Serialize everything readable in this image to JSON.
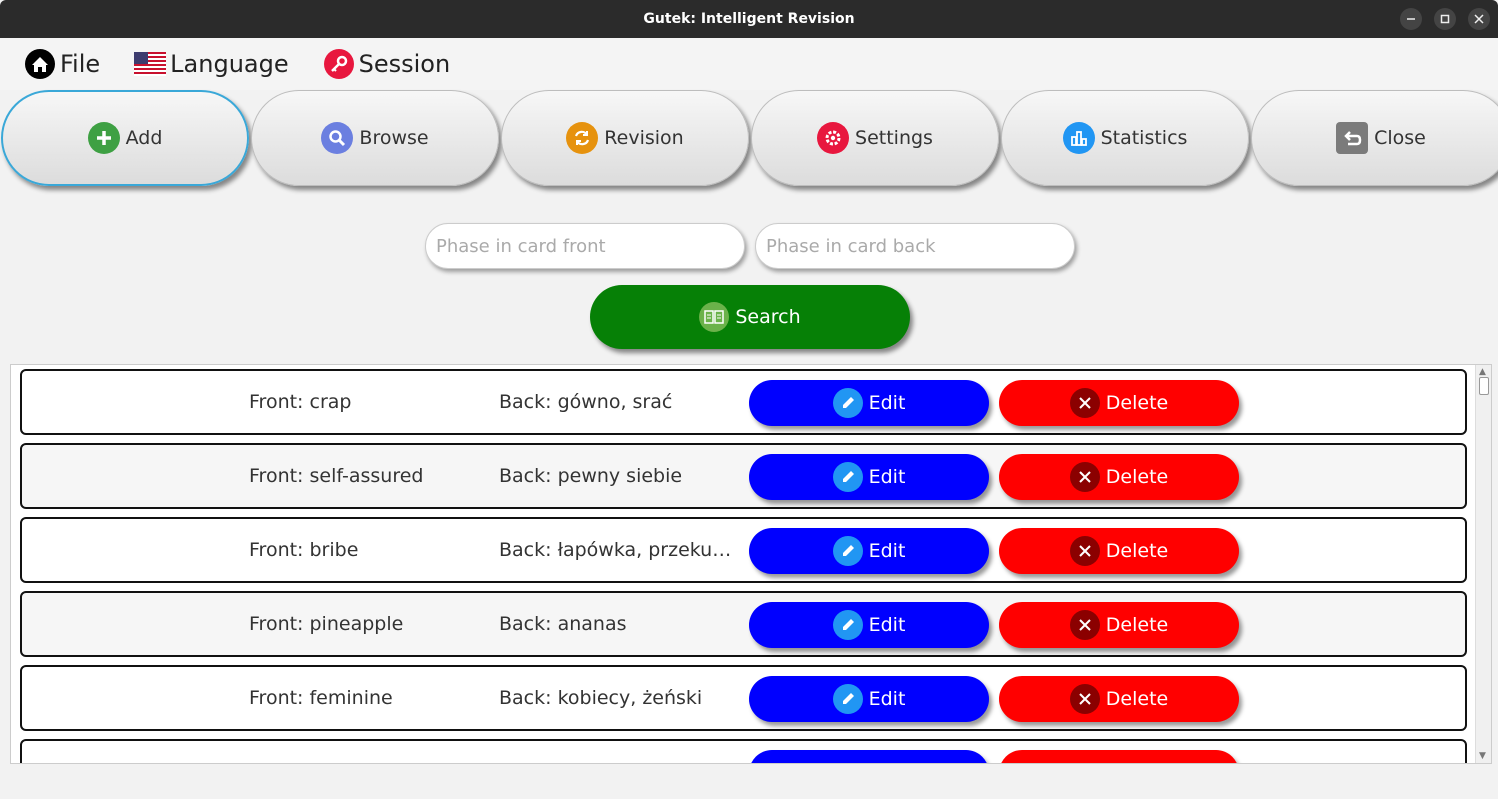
{
  "window": {
    "title": "Gutek: Intelligent Revision"
  },
  "menu": [
    {
      "label": "File",
      "icon": "home-icon"
    },
    {
      "label": "Language",
      "icon": "us-flag-icon"
    },
    {
      "label": "Session",
      "icon": "key-icon"
    }
  ],
  "nav": [
    {
      "label": "Add",
      "icon": "plus-icon",
      "color": "#3ea043",
      "active": true
    },
    {
      "label": "Browse",
      "icon": "search-icon",
      "color": "#6b7fe0"
    },
    {
      "label": "Revision",
      "icon": "refresh-icon",
      "color": "#e6920e"
    },
    {
      "label": "Settings",
      "icon": "gear-icon",
      "color": "#e8173e"
    },
    {
      "label": "Statistics",
      "icon": "bar-chart-icon",
      "color": "#2196f3"
    },
    {
      "label": "Close",
      "icon": "back-arrow-icon",
      "color": "#7b7b7b"
    }
  ],
  "search": {
    "front_placeholder": "Phase in card front",
    "back_placeholder": "Phase in card back",
    "button_label": "Search"
  },
  "cards": [
    {
      "front": "Front: crap",
      "back": "Back: gówno, srać"
    },
    {
      "front": "Front: self-assured",
      "back": "Back: pewny siebie"
    },
    {
      "front": "Front: bribe",
      "back": "Back: łapówka, przekupy..."
    },
    {
      "front": "Front: pineapple",
      "back": "Back: ananas"
    },
    {
      "front": "Front: feminine",
      "back": "Back: kobiecy, żeński"
    }
  ],
  "actions": {
    "edit_label": "Edit",
    "delete_label": "Delete"
  },
  "colors": {
    "edit": "#0000ff",
    "delete": "#ff0000",
    "search": "#068006"
  }
}
